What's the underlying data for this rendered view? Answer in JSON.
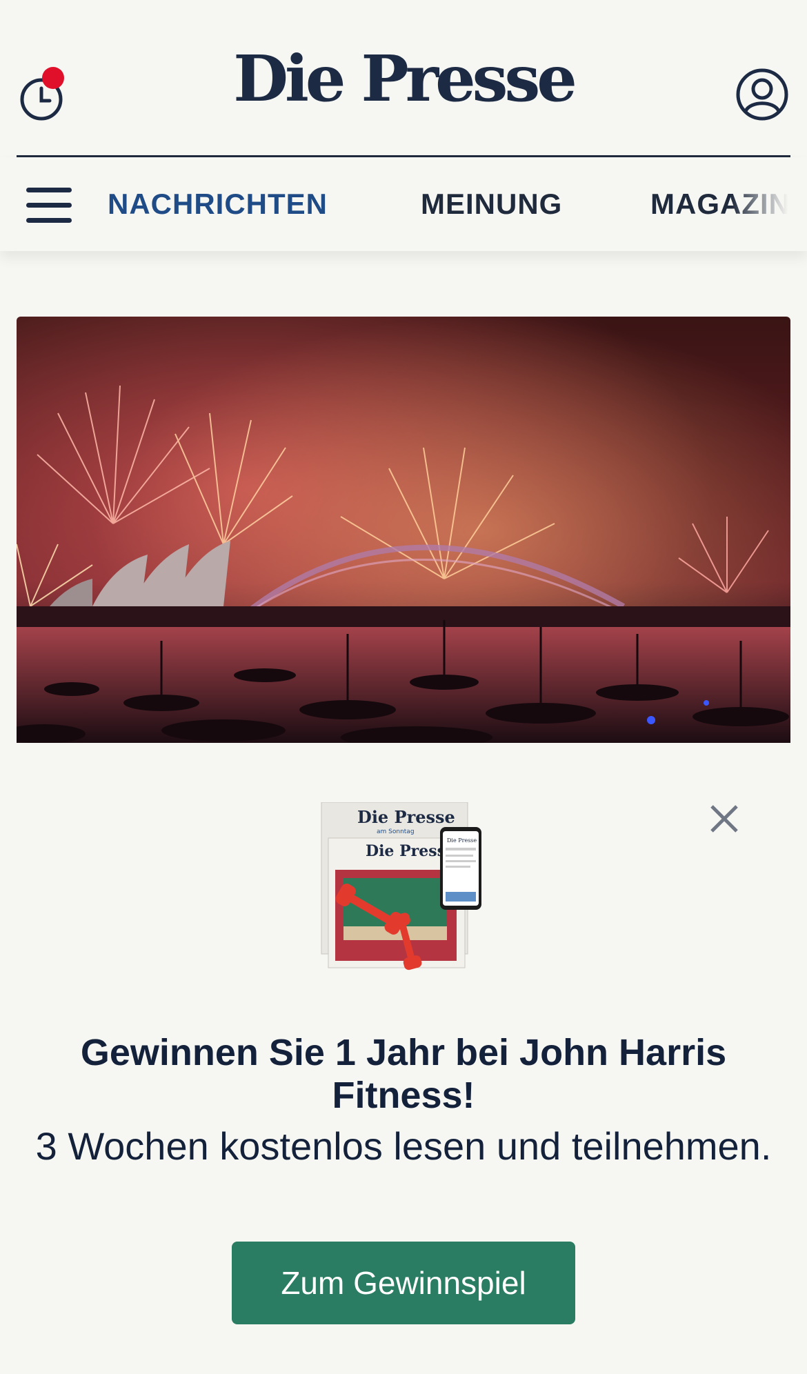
{
  "header": {
    "logo_text": "Die Presse",
    "history_icon": "clock-icon",
    "notification_color": "#e0102a",
    "account_icon": "user-circle-icon"
  },
  "nav": {
    "menu_icon": "hamburger-menu-icon",
    "items": [
      {
        "label": "NACHRICHTEN",
        "active": true
      },
      {
        "label": "MEINUNG",
        "active": false
      },
      {
        "label": "MAGAZIN",
        "active": false
      }
    ],
    "active_color": "#1f4c86"
  },
  "hero": {
    "image": "fireworks-over-sydney-harbour"
  },
  "promo": {
    "close_icon": "close-icon",
    "visual": {
      "paper_1_title": "Die Presse",
      "paper_1_subtitle": "am Sonntag",
      "paper_2_title": "Die Presse",
      "phone_title": "Die Presse",
      "dumbbell_icon": "dumbbell-icon"
    },
    "headline": "Gewinnen Sie 1 Jahr bei John Harris Fitness!",
    "subline": "3 Wochen kostenlos lesen und teilnehmen.",
    "cta_label": "Zum Gewinnspiel",
    "cta_color": "#2a7d62"
  }
}
